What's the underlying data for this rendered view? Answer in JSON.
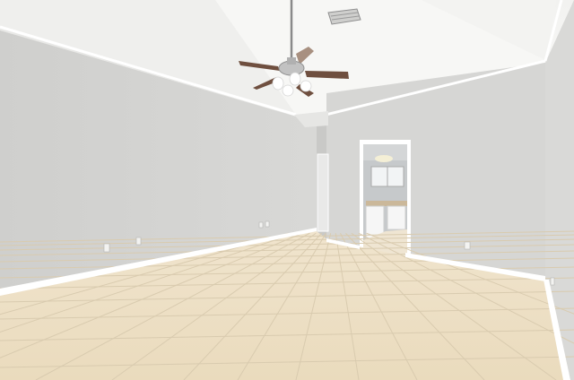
{
  "scene": {
    "subject": "empty-room-interior",
    "colors": {
      "wall": "#d3d3d1",
      "wall_light": "#dcdcda",
      "right_wall": "#d9d9d7",
      "ceiling": "#f4f4f2",
      "trim": "#ffffff",
      "floor_tile": "#efe1c8",
      "grout": "#d8cbb1",
      "fan_blade": "#7a5a4a",
      "fan_metal": "#b8b8b8",
      "bathroom_wall": "#c9ccce",
      "cabinet": "#f6f6f6",
      "countertop": "#cbb89a"
    }
  }
}
